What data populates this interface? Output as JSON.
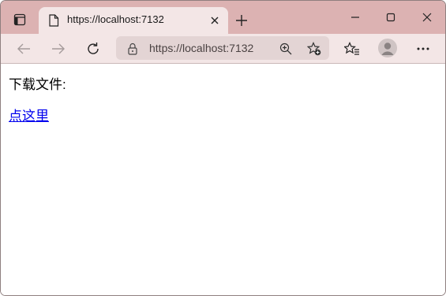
{
  "browser": {
    "tab": {
      "title": "https://localhost:7132"
    },
    "address_bar": {
      "url": "https://localhost:7132"
    }
  },
  "page": {
    "label": "下载文件:",
    "link_text": "点这里"
  },
  "colors": {
    "tabstrip_bg": "#dcb2b2",
    "toolbar_bg": "#f3e6e6",
    "link": "#0000ee"
  }
}
